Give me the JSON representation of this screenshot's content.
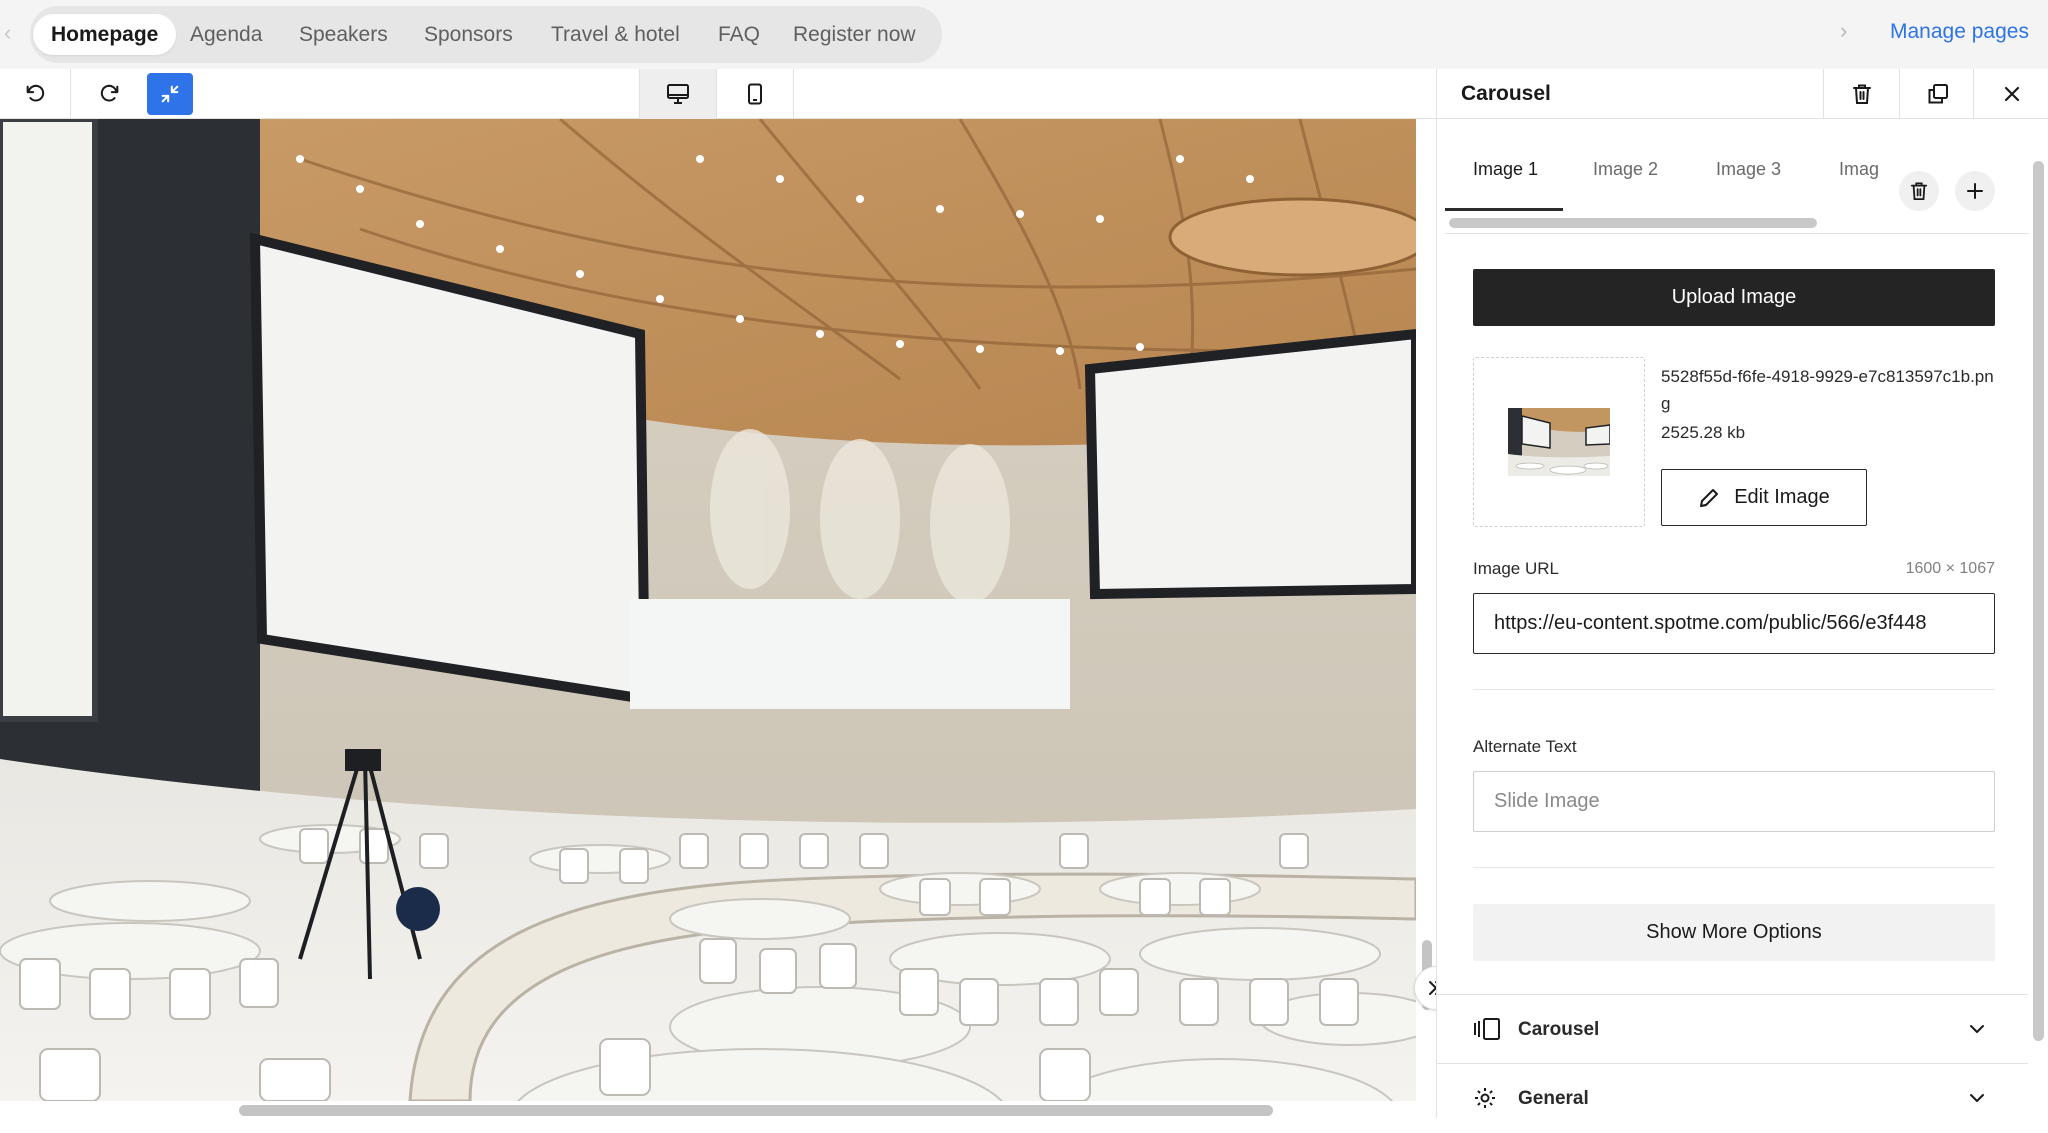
{
  "page_tabs": {
    "items": [
      "Homepage",
      "Agenda",
      "Speakers",
      "Sponsors",
      "Travel & hotel",
      "FAQ",
      "Register now"
    ],
    "active": "Homepage",
    "manage_label": "Manage pages"
  },
  "toolbar": {
    "undo_icon": "undo-icon",
    "redo_icon": "redo-icon",
    "collapse_icon": "minimize-icon",
    "desktop_icon": "desktop-icon",
    "mobile_icon": "mobile-icon",
    "accent": "#2e73e8"
  },
  "canvas": {
    "image_description_icon": "conference-hall-image"
  },
  "panel": {
    "title": "Carousel",
    "image_tabs": [
      "Image 1",
      "Image 2",
      "Image 3",
      "Imag"
    ],
    "active_image_tab": "Image 1",
    "upload_label": "Upload Image",
    "file_name": "5528f55d-f6fe-4918-9929-e7c813597c1b.png",
    "file_size": "2525.28 kb",
    "edit_label": "Edit Image",
    "image_url_label": "Image URL",
    "dimensions": "1600 × 1067",
    "image_url_value": "https://eu-content.spotme.com/public/566/e3f448",
    "alt_text_label": "Alternate Text",
    "alt_text_placeholder": "Slide Image",
    "more_options_label": "Show More Options",
    "sections": [
      "Carousel",
      "General"
    ]
  }
}
